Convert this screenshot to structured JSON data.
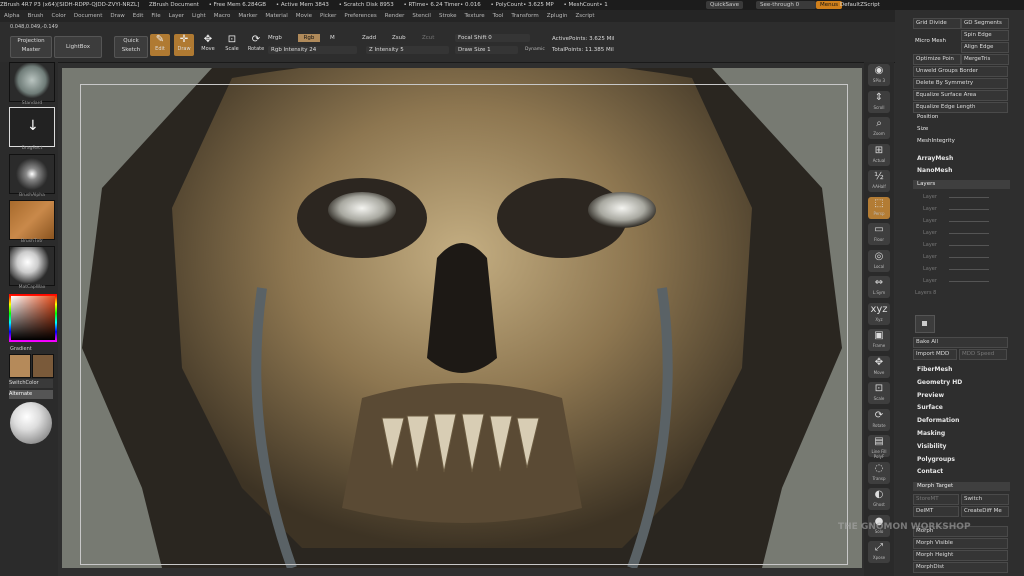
{
  "titlebar": {
    "app": "ZBrush 4R7 P3 (x64)[SIDH-RDPP-QJDD-ZVYI-NRZL]",
    "doc": "ZBrush Document",
    "free_mem": "• Free Mem 6.284GB",
    "active_mem": "• Active Mem 3843",
    "scratch": "• Scratch Disk 8953",
    "rtime": "• RTime• 6.24 Timer• 0.016",
    "polycount": "• PolyCount• 3.625 MP",
    "meshcount": "• MeshCount• 1",
    "quicksave": "QuickSave",
    "see_through": "See-through  0",
    "menus": "Menus",
    "default_script": "DefaultZScript"
  },
  "menubar": [
    "Alpha",
    "Brush",
    "Color",
    "Document",
    "Draw",
    "Edit",
    "File",
    "Layer",
    "Light",
    "Macro",
    "Marker",
    "Material",
    "Movie",
    "Picker",
    "Preferences",
    "Render",
    "Stencil",
    "Stroke",
    "Texture",
    "Tool",
    "Transform",
    "Zplugin",
    "Zscript"
  ],
  "coords": "0.048,0.049,-0.149",
  "shelf": {
    "projection_master": "Projection Master",
    "lightbox": "LightBox",
    "quick_sketch": "Quick Sketch",
    "edit": "Edit",
    "draw": "Draw",
    "move": "Move",
    "scale": "Scale",
    "rotate": "Rotate",
    "mrgb": "Mrgb",
    "rgb": "Rgb",
    "m": "M",
    "zadd": "Zadd",
    "zsub": "Zsub",
    "zcut": "Zcut",
    "rgb_intensity": "Rgb Intensity 24",
    "z_intensity": "Z Intensity 5",
    "focal_shift": "Focal Shift 0",
    "draw_size": "Draw Size 1",
    "dynamic": "Dynamic",
    "active_points": "ActivePoints: 3.625 Mil",
    "total_points": "TotalPoints: 11.385 Mil"
  },
  "left": {
    "standard": "Standard",
    "dragrect": "DragRect",
    "brushalpha": "BrushAlpha",
    "brushtxtr": "BrushTxtr",
    "matcap": "MatCapWax",
    "gradient": "Gradient",
    "switchcolor": "SwitchColor",
    "alternate": "Alternate"
  },
  "rdock": [
    "SPix 3",
    "Scroll",
    "Zoom",
    "Actual",
    "AAHalf",
    "Persp",
    "Floor",
    "Local",
    "L.Sym",
    "Xyz",
    "Frame",
    "Move",
    "Scale",
    "Rotate",
    "Line Fill PolyF",
    "Transp",
    "Ghost",
    "Solo",
    "Xpose"
  ],
  "rmenu": {
    "grid_divide": "Grid Divide",
    "gd_segments": "GD Segments",
    "spin_edge": "Spin Edge",
    "micro_mesh": "Micro Mesh",
    "align_edge": "Align Edge",
    "optimize_points": "Optimize Poin",
    "merge_tris": "MergeTris",
    "unweld_groups": "Unweld Groups Border",
    "delete_by_symmetry": "Delete By Symmetry",
    "equalize_area": "Equalize Surface Area",
    "equalize_edge": "Equalize Edge Length",
    "position": "Position",
    "size": "Size",
    "mesh_integrity": "MeshIntegrity",
    "array_mesh": "ArrayMesh",
    "nano_mesh": "NanoMesh",
    "layers": "Layers",
    "layer_rows": [
      "Layer",
      "Layer",
      "Layer",
      "Layer",
      "Layer",
      "Layer",
      "Layer",
      "Layer"
    ],
    "layers_count": "Layers 8",
    "bake_all": "Bake All",
    "import_mdd": "Import MDD",
    "mdd_speed": "MDD Speed",
    "sections": [
      "FiberMesh",
      "Geometry HD",
      "Preview",
      "Surface",
      "Deformation",
      "Masking",
      "Visibility",
      "Polygroups",
      "Contact"
    ],
    "morph_target": "Morph Target",
    "storemt": "StoreMT",
    "switch": "Switch",
    "delmt": "DelMT",
    "creatediff": "CreateDiff Me",
    "morph": "Morph",
    "morph_visible": "Morph Visible",
    "morph_height": "Morph Height",
    "morph_dist": "MorphDist"
  },
  "watermark": "THE GNOMON WORKSHOP",
  "colors": {
    "accent": "#d0801c",
    "bg": "#2f2f2f",
    "canvas": "#777a72"
  }
}
